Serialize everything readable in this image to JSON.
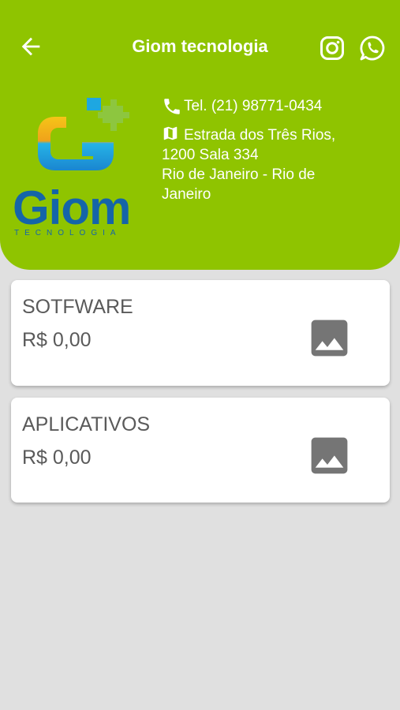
{
  "header": {
    "title": "Giom tecnologia",
    "back_icon": "arrow-left-icon",
    "instagram_icon": "instagram-icon",
    "whatsapp_icon": "whatsapp-icon",
    "background_color": "#8fc400"
  },
  "logo": {
    "text": "Giom",
    "subtext": "TECNOLOGIA"
  },
  "contact": {
    "phone": "Tel. (21) 98771-0434",
    "address_line1": "Estrada dos Três Rios,",
    "address_line2": "1200 Sala 334",
    "address_line3": "Rio de Janeiro - Rio de",
    "address_line4": "Janeiro"
  },
  "categories": [
    {
      "name": "SOTFWARE",
      "price": "R$ 0,00",
      "icon": "image-placeholder-icon"
    },
    {
      "name": "APLICATIVOS",
      "price": "R$ 0,00",
      "icon": "image-placeholder-icon"
    }
  ]
}
